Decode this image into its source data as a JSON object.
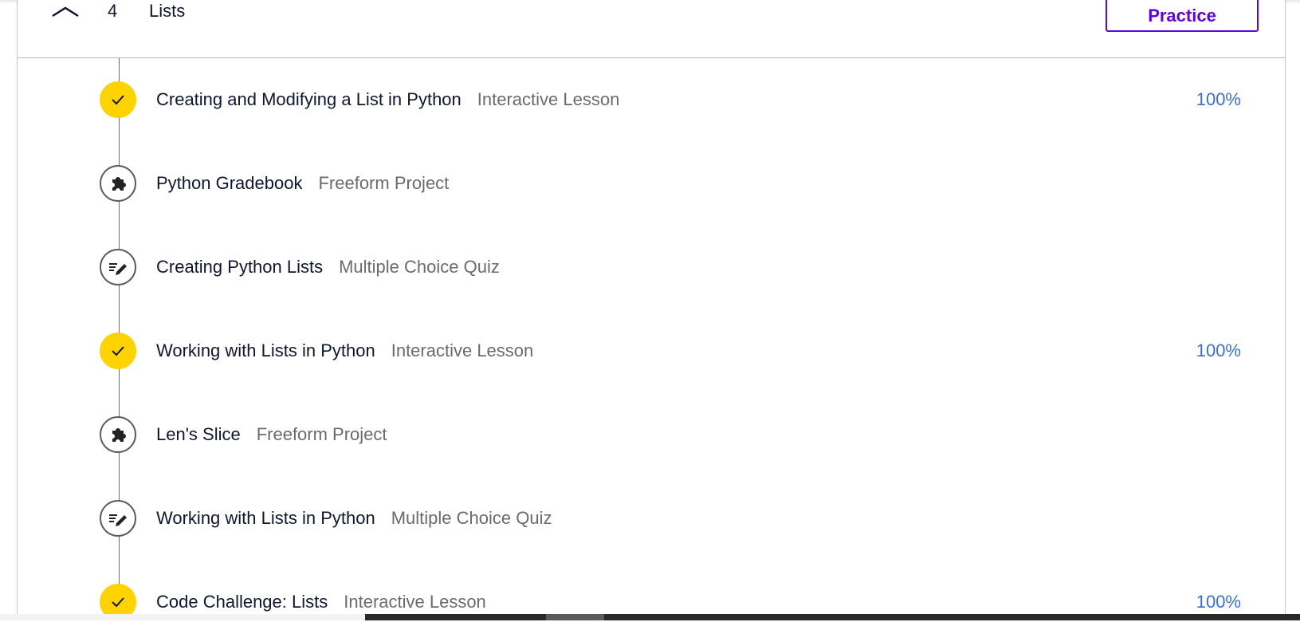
{
  "module": {
    "number": "4",
    "title": "Lists",
    "practice_label": "Practice",
    "collapse_icon": "chevron-up-icon"
  },
  "items": [
    {
      "title": "Creating and Modifying a List in Python",
      "type": "Interactive Lesson",
      "progress": "100%",
      "status": "complete",
      "icon": "check-icon"
    },
    {
      "title": "Python Gradebook",
      "type": "Freeform Project",
      "progress": "",
      "status": "incomplete",
      "icon": "puzzle-icon"
    },
    {
      "title": "Creating Python Lists",
      "type": "Multiple Choice Quiz",
      "progress": "",
      "status": "incomplete",
      "icon": "quiz-pencil-icon"
    },
    {
      "title": "Working with Lists in Python",
      "type": "Interactive Lesson",
      "progress": "100%",
      "status": "complete",
      "icon": "check-icon"
    },
    {
      "title": "Len's Slice",
      "type": "Freeform Project",
      "progress": "",
      "status": "incomplete",
      "icon": "puzzle-icon"
    },
    {
      "title": "Working with Lists in Python",
      "type": "Multiple Choice Quiz",
      "progress": "",
      "status": "incomplete",
      "icon": "quiz-pencil-icon"
    },
    {
      "title": "Code Challenge: Lists",
      "type": "Interactive Lesson",
      "progress": "100%",
      "status": "complete",
      "icon": "check-icon"
    }
  ],
  "colors": {
    "accent_purple": "#6400e4",
    "complete_yellow": "#ffd300",
    "progress_blue": "#3a6fd8"
  }
}
